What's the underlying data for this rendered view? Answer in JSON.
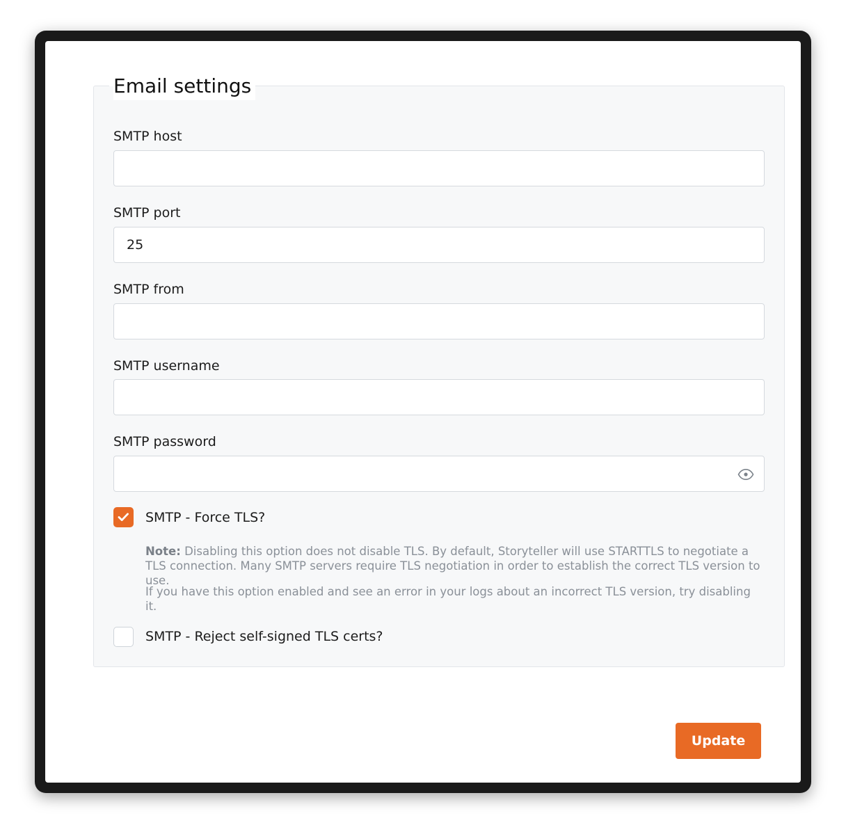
{
  "section": {
    "title": "Email settings"
  },
  "fields": {
    "smtp_host": {
      "label": "SMTP host",
      "value": ""
    },
    "smtp_port": {
      "label": "SMTP port",
      "value": "25"
    },
    "smtp_from": {
      "label": "SMTP from",
      "value": ""
    },
    "smtp_username": {
      "label": "SMTP username",
      "value": ""
    },
    "smtp_password": {
      "label": "SMTP password",
      "value": "",
      "icon": "eye-icon"
    }
  },
  "force_tls": {
    "label": "SMTP - Force TLS?",
    "checked": true,
    "note_bold": "Note:",
    "note_text": " Disabling this option does not disable TLS. By default, Storyteller will use STARTTLS to negotiate a TLS connection. Many SMTP servers require TLS negotiation in order to establish the correct TLS version to use.",
    "note_text2": "If you have this option enabled and see an error in your logs about an incorrect TLS version, try disabling it."
  },
  "reject_self_signed": {
    "label": "SMTP - Reject self-signed TLS certs?",
    "checked": false
  },
  "actions": {
    "update_label": "Update"
  },
  "colors": {
    "accent": "#e86a25",
    "panel_bg": "#f7f8f9",
    "border": "#d5d9de",
    "note_text": "#8a9098"
  }
}
